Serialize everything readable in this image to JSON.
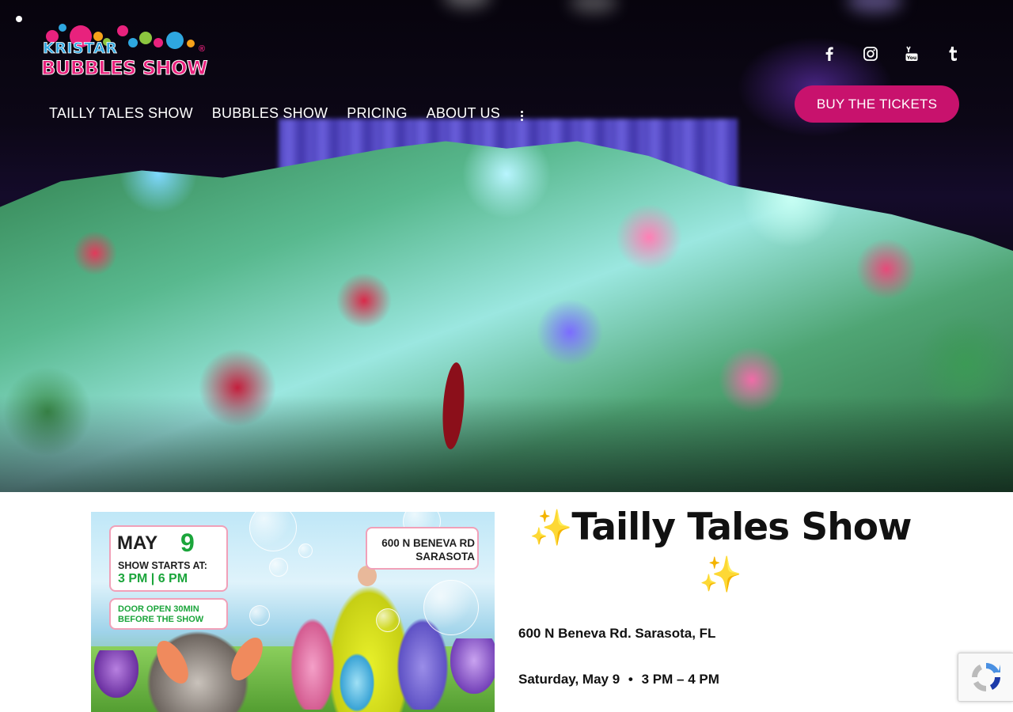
{
  "brand": {
    "logo_line1": "KRISTAR",
    "logo_line2": "BUBBLES SHOW",
    "registered": "®"
  },
  "nav": {
    "items": [
      {
        "label": "TAILLY TALES SHOW"
      },
      {
        "label": "BUBBLES SHOW"
      },
      {
        "label": "PRICING"
      },
      {
        "label": "ABOUT US"
      }
    ],
    "more_icon": "vertical-ellipsis-icon"
  },
  "social": [
    "facebook-icon",
    "instagram-icon",
    "youtube-icon",
    "tumblr-icon"
  ],
  "cta": {
    "buy_label": "BUY THE TICKETS"
  },
  "colors": {
    "accent": "#c8126d",
    "logo_blue": "#2ea7e0",
    "logo_pink": "#e8227d",
    "poster_green": "#1ba53b"
  },
  "poster": {
    "month": "MAY",
    "day": "9",
    "starts_label": "SHOW STARTS AT:",
    "times": "3 PM | 6 PM",
    "door_line1": "DOOR OPEN 30MIN",
    "door_line2": "BEFORE THE SHOW",
    "addr_line1": "600 N BENEVA RD",
    "addr_line2": "SARASOTA"
  },
  "event": {
    "sparkle": "✨",
    "title": "Tailly Tales Show",
    "address": "600 N Beneva Rd. Sarasota, FL",
    "date": "Saturday, May 9",
    "separator": "•",
    "time": "3 PM – 4 PM"
  }
}
